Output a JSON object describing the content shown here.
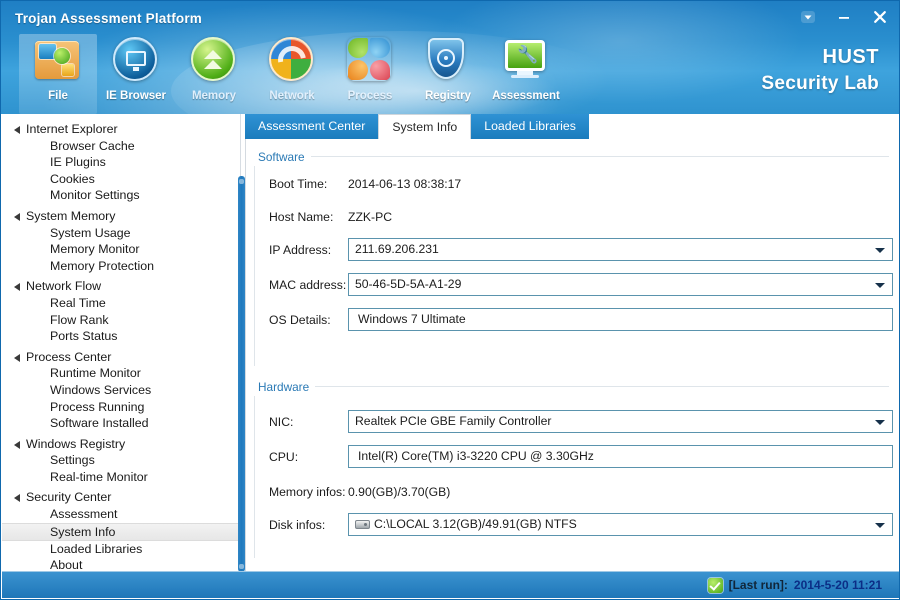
{
  "window": {
    "title": "Trojan Assessment Platform",
    "controls": [
      {
        "name": "dropdown-menu-button",
        "glyph": "chevron-down"
      },
      {
        "name": "minimize-button",
        "glyph": "minus"
      },
      {
        "name": "close-button",
        "glyph": "close"
      }
    ]
  },
  "brand": {
    "line1": "HUST",
    "line2": "Security Lab"
  },
  "toolbar": {
    "items": [
      {
        "label": "File",
        "icon": "folder-icon",
        "active": true
      },
      {
        "label": "IE Browser",
        "icon": "monitor-icon",
        "active": false
      },
      {
        "label": "Memory",
        "icon": "double-chevron-up-icon",
        "active": false
      },
      {
        "label": "Network",
        "icon": "network-refresh-icon",
        "active": false
      },
      {
        "label": "Process",
        "icon": "four-squares-icon",
        "active": false
      },
      {
        "label": "Registry",
        "icon": "shield-target-icon",
        "active": false
      },
      {
        "label": "Assessment",
        "icon": "monitor-wrench-icon",
        "active": false
      }
    ]
  },
  "sidebar": {
    "nodes": [
      {
        "label": "Internet Explorer",
        "type": "group"
      },
      {
        "label": "Browser Cache",
        "type": "leaf"
      },
      {
        "label": "IE Plugins",
        "type": "leaf"
      },
      {
        "label": "Cookies",
        "type": "leaf"
      },
      {
        "label": "Monitor Settings",
        "type": "leaf"
      },
      {
        "label": "System Memory",
        "type": "group"
      },
      {
        "label": "System Usage",
        "type": "leaf"
      },
      {
        "label": "Memory Monitor",
        "type": "leaf"
      },
      {
        "label": "Memory Protection",
        "type": "leaf"
      },
      {
        "label": "Network Flow",
        "type": "group"
      },
      {
        "label": "Real Time",
        "type": "leaf"
      },
      {
        "label": "Flow Rank",
        "type": "leaf"
      },
      {
        "label": "Ports Status",
        "type": "leaf"
      },
      {
        "label": "Process Center",
        "type": "group"
      },
      {
        "label": "Runtime Monitor",
        "type": "leaf"
      },
      {
        "label": "Windows Services",
        "type": "leaf"
      },
      {
        "label": "Process Running",
        "type": "leaf"
      },
      {
        "label": "Software Installed",
        "type": "leaf"
      },
      {
        "label": "Windows Registry",
        "type": "group"
      },
      {
        "label": "Settings",
        "type": "leaf"
      },
      {
        "label": "Real-time Monitor",
        "type": "leaf"
      },
      {
        "label": "Security Center",
        "type": "group"
      },
      {
        "label": "Assessment",
        "type": "leaf"
      },
      {
        "label": "System Info",
        "type": "leaf",
        "selected": true
      },
      {
        "label": "Loaded Libraries",
        "type": "leaf"
      },
      {
        "label": "About",
        "type": "leaf"
      }
    ]
  },
  "tabs": [
    {
      "label": "Assessment Center",
      "active": false
    },
    {
      "label": "System Info",
      "active": true
    },
    {
      "label": "Loaded Libraries",
      "active": false
    }
  ],
  "software": {
    "title": "Software",
    "fields": [
      {
        "label": "Boot Time:",
        "value": "2014-06-13 08:38:17",
        "kind": "text"
      },
      {
        "label": "Host Name:",
        "value": "ZZK-PC",
        "kind": "text"
      },
      {
        "label": "IP Address:",
        "value": "211.69.206.231",
        "kind": "combo"
      },
      {
        "label": "MAC address:",
        "value": "50-46-5D-5A-A1-29",
        "kind": "combo"
      },
      {
        "label": "OS Details:",
        "value": "Windows 7 Ultimate",
        "kind": "input"
      }
    ]
  },
  "hardware": {
    "title": "Hardware",
    "fields": [
      {
        "label": "NIC:",
        "value": "Realtek PCIe GBE Family Controller",
        "kind": "combo"
      },
      {
        "label": "CPU:",
        "value": "Intel(R) Core(TM) i3-3220 CPU @ 3.30GHz",
        "kind": "input"
      },
      {
        "label": "Memory infos:",
        "value": "0.90(GB)/3.70(GB)",
        "kind": "text"
      },
      {
        "label": "Disk infos:",
        "value": "C:\\LOCAL  3.12(GB)/49.91(GB)  NTFS",
        "kind": "combo-disk"
      }
    ]
  },
  "statusbar": {
    "icon": "green-check-icon",
    "label": "[Last run]:",
    "value": "2014-5-20 11:21"
  },
  "colors": {
    "banner_blue": "#2a8fcf",
    "tab_blue": "#1b7cbd",
    "group_title": "#2b7ab5",
    "status_value": "#0b2e86",
    "field_border": "#5a93ad"
  }
}
